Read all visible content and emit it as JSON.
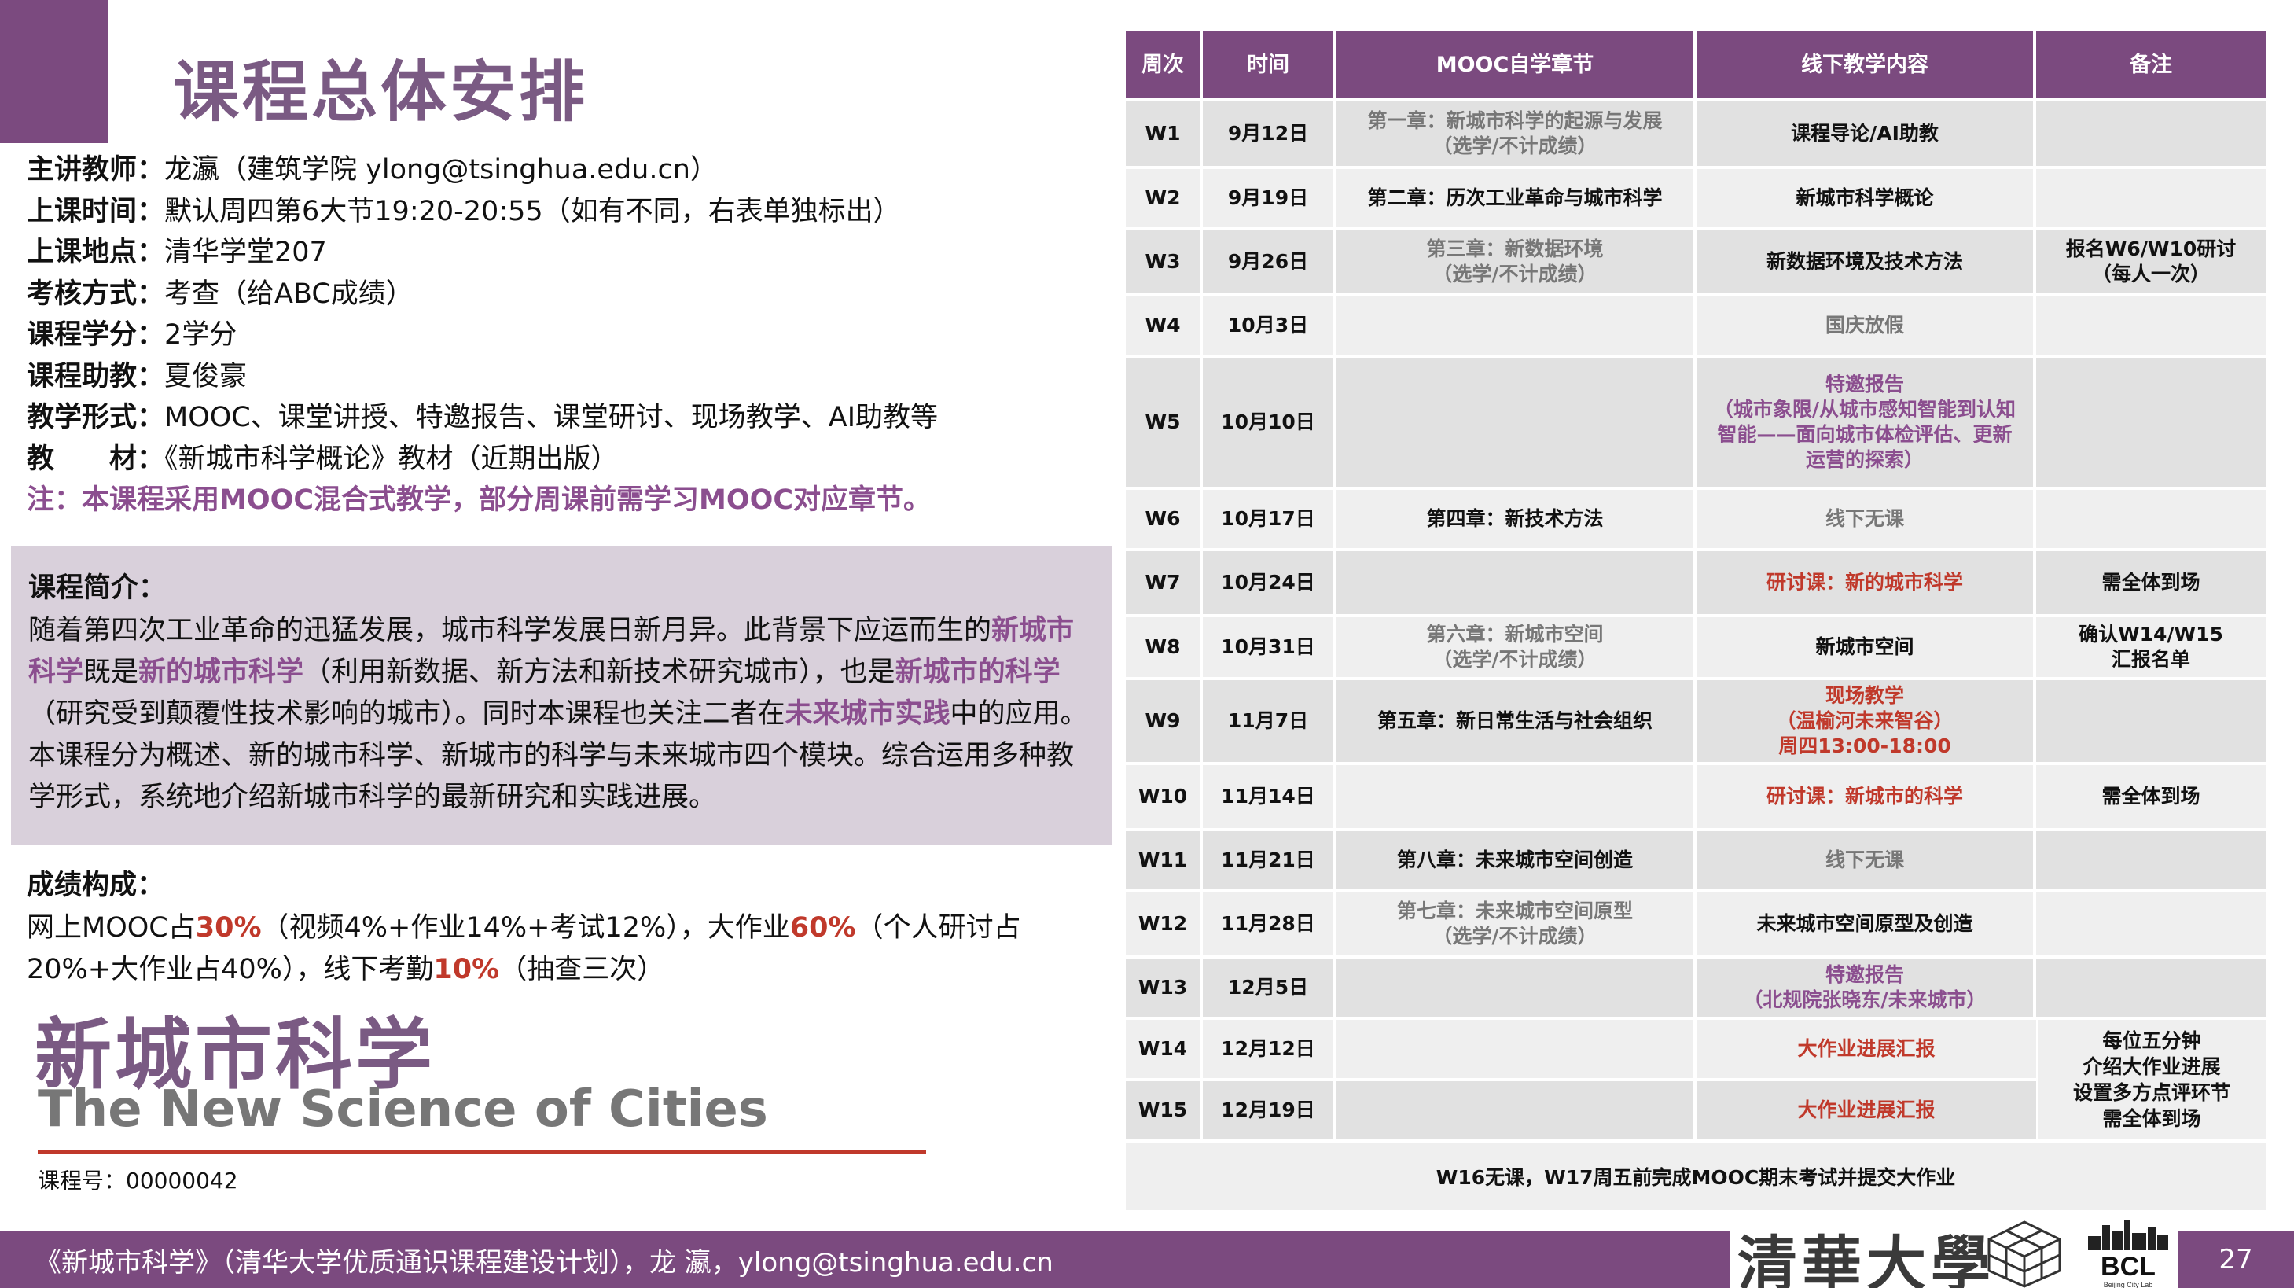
{
  "title": "课程总体安排",
  "info": [
    {
      "label": "主讲教师：",
      "value": "龙瀛（建筑学院 ylong@tsinghua.edu.cn）"
    },
    {
      "label": "上课时间：",
      "value": "默认周四第6大节19:20-20:55（如有不同，右表单独标出）"
    },
    {
      "label": "上课地点：",
      "value": "清华学堂207"
    },
    {
      "label": "考核方式：",
      "value": "考查（给ABC成绩）"
    },
    {
      "label": "课程学分：",
      "value": "2学分"
    },
    {
      "label": "课程助教：",
      "value": "夏俊豪"
    },
    {
      "label": "教学形式：",
      "value": "MOOC、课堂讲授、特邀报告、课堂研讨、现场教学、AI助教等"
    },
    {
      "label": "教　　材：",
      "value": "《新城市科学概论》教材（近期出版）"
    }
  ],
  "note": "注：本课程采用MOOC混合式教学，部分周课前需学习MOOC对应章节。",
  "intro": {
    "heading": "课程简介：",
    "p1": "随着第四次工业革命的迅猛发展，城市科学发展日新月异。此背景下应运而生的",
    "h1": "新城市科学",
    "p2": "既是",
    "h2": "新的城市科学",
    "p3": "（利用新数据、新方法和新技术研究城市），也是",
    "h3": "新城市的科学",
    "p4": "（研究受到颠覆性技术影响的城市）。同时本课程也关注二者在",
    "h4": "未来城市实践",
    "p5": "中的应用。本课程分为概述、新的城市科学、新城市的科学与未来城市四个模块。综合运用多种教学形式，系统地介绍新城市科学的最新研究和实践进展。"
  },
  "grade": {
    "heading": "成绩构成：",
    "t1": "网上MOOC占",
    "v1": "30%",
    "t2": "（视频4%+作业14%+考试12%），大作业",
    "v2": "60%",
    "t3": "（个人研讨占20%+大作业占40%），线下考勤",
    "v3": "10%",
    "t4": "（抽查三次）"
  },
  "brand": {
    "cn": "新城市科学",
    "en": "The New Science of Cities",
    "course_no": "课程号：00000042"
  },
  "table": {
    "headers": [
      "周次",
      "时间",
      "MOOC自学章节",
      "线下教学内容",
      "备注"
    ],
    "rows": [
      {
        "week": "W1",
        "date": "9月12日",
        "mooc": [
          "第一章：新城市科学的起源与发展",
          "（选学/不计成绩）"
        ],
        "mooc_style": "gray",
        "offline": [
          "课程导论/AI助教"
        ],
        "offline_style": "",
        "note": []
      },
      {
        "week": "W2",
        "date": "9月19日",
        "mooc": [
          "第二章：历次工业革命与城市科学"
        ],
        "mooc_style": "",
        "offline": [
          "新城市科学概论"
        ],
        "offline_style": "",
        "note": []
      },
      {
        "week": "W3",
        "date": "9月26日",
        "mooc": [
          "第三章：新数据环境",
          "（选学/不计成绩）"
        ],
        "mooc_style": "gray",
        "offline": [
          "新数据环境及技术方法"
        ],
        "offline_style": "",
        "note": [
          "报名W6/W10研讨",
          "（每人一次）"
        ]
      },
      {
        "week": "W4",
        "date": "10月3日",
        "mooc": [],
        "mooc_style": "",
        "offline": [
          "国庆放假"
        ],
        "offline_style": "gray",
        "note": []
      },
      {
        "week": "W5",
        "date": "10月10日",
        "mooc": [],
        "mooc_style": "",
        "offline": [
          "特邀报告",
          "（城市象限/从城市感知智能到认知",
          "智能——面向城市体检评估、更新",
          "运营的探索）"
        ],
        "offline_style": "purple",
        "note": []
      },
      {
        "week": "W6",
        "date": "10月17日",
        "mooc": [
          "第四章：新技术方法"
        ],
        "mooc_style": "",
        "offline": [
          "线下无课"
        ],
        "offline_style": "gray",
        "note": []
      },
      {
        "week": "W7",
        "date": "10月24日",
        "mooc": [],
        "mooc_style": "",
        "offline": [
          "研讨课：新的城市科学"
        ],
        "offline_style": "redt",
        "note": [
          "需全体到场"
        ]
      },
      {
        "week": "W8",
        "date": "10月31日",
        "mooc": [
          "第六章：新城市空间",
          "（选学/不计成绩）"
        ],
        "mooc_style": "gray",
        "offline": [
          "新城市空间"
        ],
        "offline_style": "",
        "note": [
          "确认W14/W15",
          "汇报名单"
        ]
      },
      {
        "week": "W9",
        "date": "11月7日",
        "mooc": [
          "第五章：新日常生活与社会组织"
        ],
        "mooc_style": "",
        "offline": [
          "现场教学",
          "（温榆河未来智谷）",
          "周四13:00-18:00"
        ],
        "offline_style": "redt",
        "note": []
      },
      {
        "week": "W10",
        "date": "11月14日",
        "mooc": [],
        "mooc_style": "",
        "offline": [
          "研讨课：新城市的科学"
        ],
        "offline_style": "redt",
        "note": [
          "需全体到场"
        ]
      },
      {
        "week": "W11",
        "date": "11月21日",
        "mooc": [
          "第八章：未来城市空间创造"
        ],
        "mooc_style": "",
        "offline": [
          "线下无课"
        ],
        "offline_style": "gray",
        "note": []
      },
      {
        "week": "W12",
        "date": "11月28日",
        "mooc": [
          "第七章：未来城市空间原型",
          "（选学/不计成绩）"
        ],
        "mooc_style": "gray",
        "offline": [
          "未来城市空间原型及创造"
        ],
        "offline_style": "",
        "note": []
      },
      {
        "week": "W13",
        "date": "12月5日",
        "mooc": [],
        "mooc_style": "",
        "offline": [
          "特邀报告",
          "（北规院张晓东/未来城市）"
        ],
        "offline_style": "purple",
        "note": []
      },
      {
        "week": "W14",
        "date": "12月12日",
        "mooc": [],
        "mooc_style": "",
        "offline": [
          "大作业进展汇报"
        ],
        "offline_style": "redt",
        "note": []
      },
      {
        "week": "W15",
        "date": "12月19日",
        "mooc": [],
        "mooc_style": "",
        "offline": [
          "大作业进展汇报"
        ],
        "offline_style": "redt",
        "note": []
      }
    ],
    "merged_note": [
      "每位五分钟",
      "介绍大作业进展",
      "设置多方点评环节",
      "需全体到场"
    ],
    "footer": "W16无课，W17周五前完成MOOC期末考试并提交大作业"
  },
  "banner": "《新城市科学》（清华大学优质通识课程建设计划），龙 瀛，ylong@tsinghua.edu.cn",
  "logos": {
    "tsinghua": "清華大學",
    "bcl": "BCL",
    "bcl_sub": "Beijing City Lab"
  },
  "page_number": "27",
  "colors": {
    "accent": "#7b4a7f",
    "highlight": "#8b4e8f",
    "red": "#c0392b"
  }
}
